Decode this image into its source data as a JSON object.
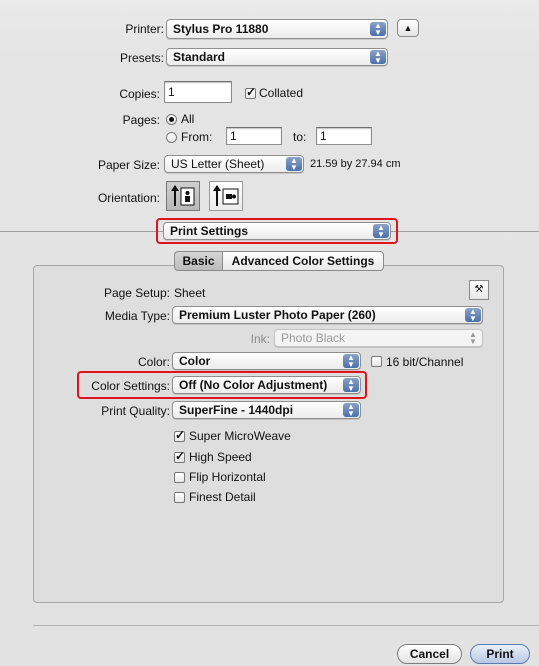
{
  "printer": {
    "label": "Printer:",
    "value": "Stylus Pro 11880"
  },
  "presets": {
    "label": "Presets:",
    "value": "Standard"
  },
  "copies": {
    "label": "Copies:",
    "value": "1",
    "collated_label": "Collated"
  },
  "pages": {
    "label": "Pages:",
    "all_label": "All",
    "from_label": "From:",
    "from_value": "1",
    "to_label": "to:",
    "to_value": "1"
  },
  "paper_size": {
    "label": "Paper Size:",
    "value": "US Letter (Sheet)",
    "dims": "21.59 by 27.94 cm"
  },
  "orientation": {
    "label": "Orientation:"
  },
  "section_popup": {
    "value": "Print Settings"
  },
  "tabs": {
    "basic": "Basic",
    "advanced": "Advanced Color Settings"
  },
  "settings": {
    "page_setup_label": "Page Setup:",
    "page_setup_value": "Sheet",
    "media_type_label": "Media Type:",
    "media_type_value": "Premium Luster Photo Paper (260)",
    "ink_label": "Ink:",
    "ink_value": "Photo Black",
    "color_label": "Color:",
    "color_value": "Color",
    "bit16_label": "16 bit/Channel",
    "color_settings_label": "Color Settings:",
    "color_settings_value": "Off (No Color Adjustment)",
    "print_quality_label": "Print Quality:",
    "print_quality_value": "SuperFine - 1440dpi",
    "options": [
      {
        "label": "Super MicroWeave",
        "checked": true
      },
      {
        "label": "High Speed",
        "checked": true
      },
      {
        "label": "Flip Horizontal",
        "checked": false
      },
      {
        "label": "Finest Detail",
        "checked": false
      }
    ]
  },
  "buttons": {
    "cancel": "Cancel",
    "print": "Print"
  },
  "colors": {
    "highlight": "#e0151b",
    "popup_arrow": "#4a6fa8"
  }
}
